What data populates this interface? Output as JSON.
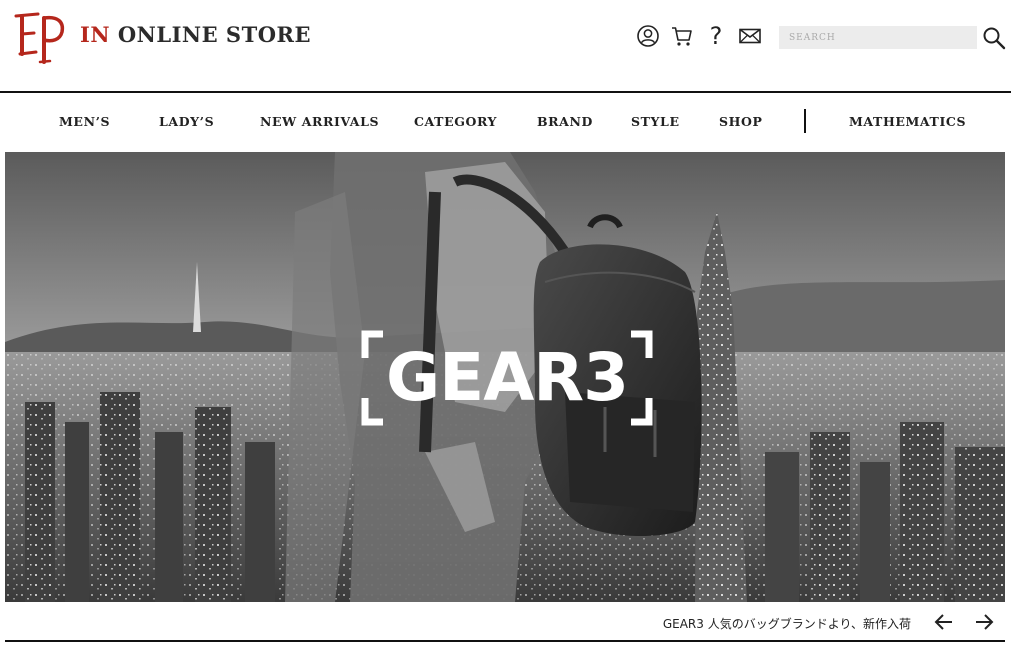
{
  "header": {
    "logo_text": "EP",
    "store_accent": "IN",
    "store_rest": " ONLINE STORE",
    "icons": [
      "account-icon",
      "cart-icon",
      "help-icon",
      "mail-icon"
    ],
    "help_glyph": "?",
    "search_placeholder": "SEARCH"
  },
  "nav": {
    "items": [
      {
        "label": "MEN’S"
      },
      {
        "label": "LADY’S"
      },
      {
        "label": "NEW ARRIVALS"
      },
      {
        "label": "CATEGORY"
      },
      {
        "label": "BRAND"
      },
      {
        "label": "STYLE"
      },
      {
        "label": "SHOP"
      },
      {
        "label": "MATHEMATICS"
      }
    ]
  },
  "hero": {
    "brand": "GEAR3",
    "caption": "GEAR3 人気のバッグブランドより、新作入荷"
  },
  "colors": {
    "accent": "#b5271c",
    "text": "#222222",
    "search_bg": "#ececec"
  }
}
